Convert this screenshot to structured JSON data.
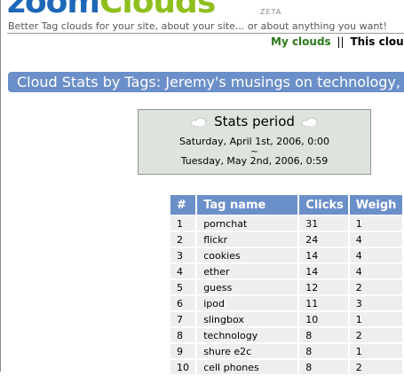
{
  "header": {
    "logo_zoom": "zoom",
    "logo_clouds": "Clouds",
    "logo_badge": "ZETA",
    "tagline": "Better Tag clouds for your site, about your site... or about anything you want!"
  },
  "nav": {
    "my_clouds": "My clouds",
    "separator": "||",
    "this_cloud": "This cloud:"
  },
  "title": "Cloud Stats by Tags: Jeremy's musings on technology,",
  "stats": {
    "heading": "Stats period",
    "start": "Saturday, April 1st, 2006, 0:00",
    "separator": "~",
    "end": "Tuesday, May 2nd, 2006, 0:59"
  },
  "table": {
    "headers": [
      "#",
      "Tag name",
      "Clicks",
      "Weigh"
    ],
    "rows": [
      [
        "1",
        "pornchat",
        "31",
        "1"
      ],
      [
        "2",
        "flickr",
        "24",
        "4"
      ],
      [
        "3",
        "cookies",
        "14",
        "4"
      ],
      [
        "4",
        "ether",
        "14",
        "4"
      ],
      [
        "5",
        "guess",
        "12",
        "2"
      ],
      [
        "6",
        "ipod",
        "11",
        "3"
      ],
      [
        "7",
        "slingbox",
        "10",
        "1"
      ],
      [
        "8",
        "technology",
        "8",
        "2"
      ],
      [
        "9",
        "shure e2c",
        "8",
        "1"
      ],
      [
        "10",
        "cell phones",
        "8",
        "2"
      ]
    ]
  },
  "colors": {
    "accent_blue": "#6b8fc8",
    "logo_blue": "#1e67b8",
    "logo_green": "#8fbf1f",
    "nav_green": "#2b7a1a"
  }
}
